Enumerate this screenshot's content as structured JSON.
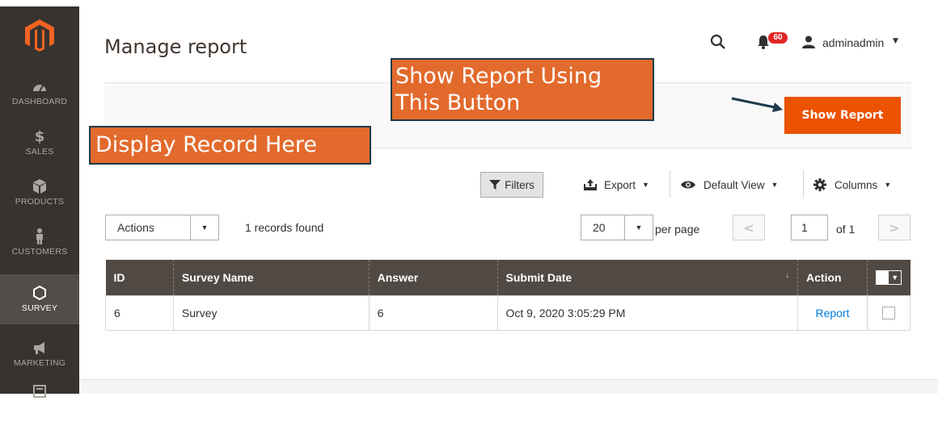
{
  "sidebar": {
    "items": [
      {
        "label": "DASHBOARD",
        "icon": "dashboard-icon"
      },
      {
        "label": "SALES",
        "icon": "dollar-icon"
      },
      {
        "label": "PRODUCTS",
        "icon": "cube-icon"
      },
      {
        "label": "CUSTOMERS",
        "icon": "person-icon"
      },
      {
        "label": "SURVEY",
        "icon": "hexagon-icon",
        "active": true
      },
      {
        "label": "MARKETING",
        "icon": "megaphone-icon"
      },
      {
        "label": "",
        "icon": "content-icon"
      }
    ]
  },
  "header": {
    "title": "Manage report",
    "notifications_count": "60",
    "user_name": "adminadmin"
  },
  "action_bar": {
    "show_report_label": "Show Report"
  },
  "annotations": {
    "display_record": "Display Record Here",
    "show_report_line1": "Show Report Using",
    "show_report_line2": "This Button"
  },
  "toolbar": {
    "filters": "Filters",
    "export": "Export",
    "default_view": "Default View",
    "columns": "Columns"
  },
  "grid_controls": {
    "actions_label": "Actions",
    "records_found": "1 records found",
    "per_page_value": "20",
    "per_page_label": "per page",
    "current_page": "1",
    "total_pages": "of 1"
  },
  "table": {
    "columns": [
      "ID",
      "Survey Name",
      "Answer",
      "Submit Date",
      "Action"
    ],
    "rows": [
      {
        "id": "6",
        "survey_name": "Survey",
        "answer": "6",
        "submit_date": "Oct 9, 2020 3:05:29 PM",
        "action": "Report"
      }
    ]
  },
  "colors": {
    "sidebar_bg": "#373330",
    "primary_button": "#eb5202",
    "table_header": "#514943",
    "link": "#007bdb",
    "callout_bg": "#e26a2c",
    "badge": "#e22626"
  }
}
